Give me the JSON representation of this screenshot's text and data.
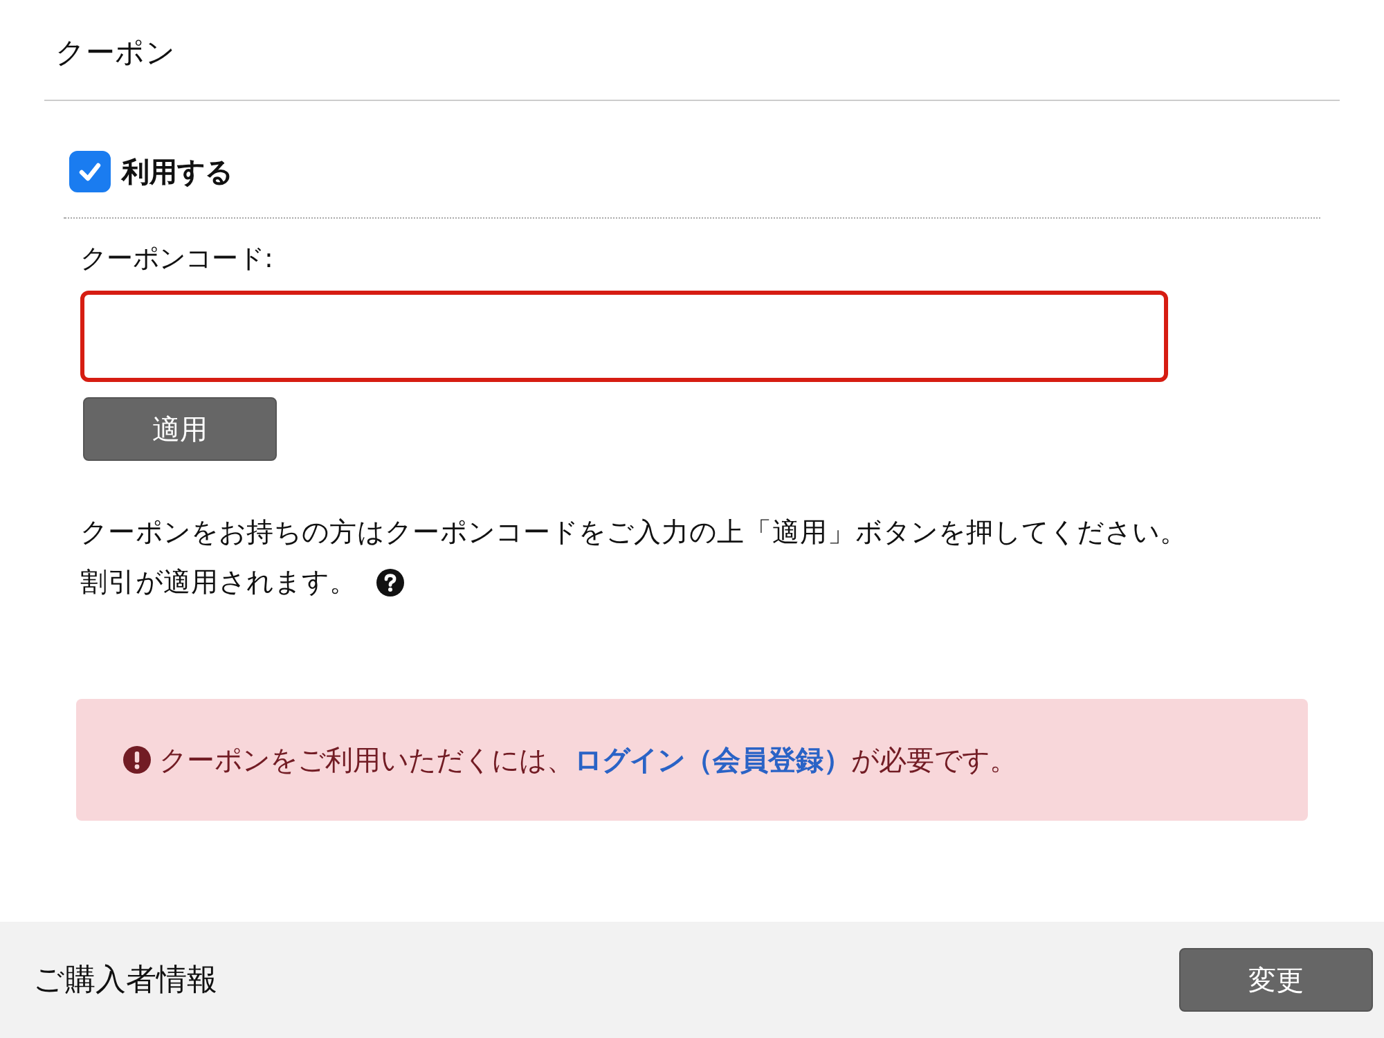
{
  "section_title": "クーポン",
  "use_coupon": {
    "label": "利用する",
    "checked": true
  },
  "coupon_code": {
    "label": "クーポンコード:",
    "error": true
  },
  "apply_button": "適用",
  "help_lines": [
    "クーポンをお持ちの方はクーポンコードをご入力の上「適用」ボタンを押してください。",
    "割引が適用されます。"
  ],
  "alert": {
    "before": "クーポンをご利用いただくには、",
    "link": "ログイン（会員登録）",
    "after": "が必要です。"
  },
  "footer": {
    "title": "ご購入者情報",
    "button": "変更"
  }
}
